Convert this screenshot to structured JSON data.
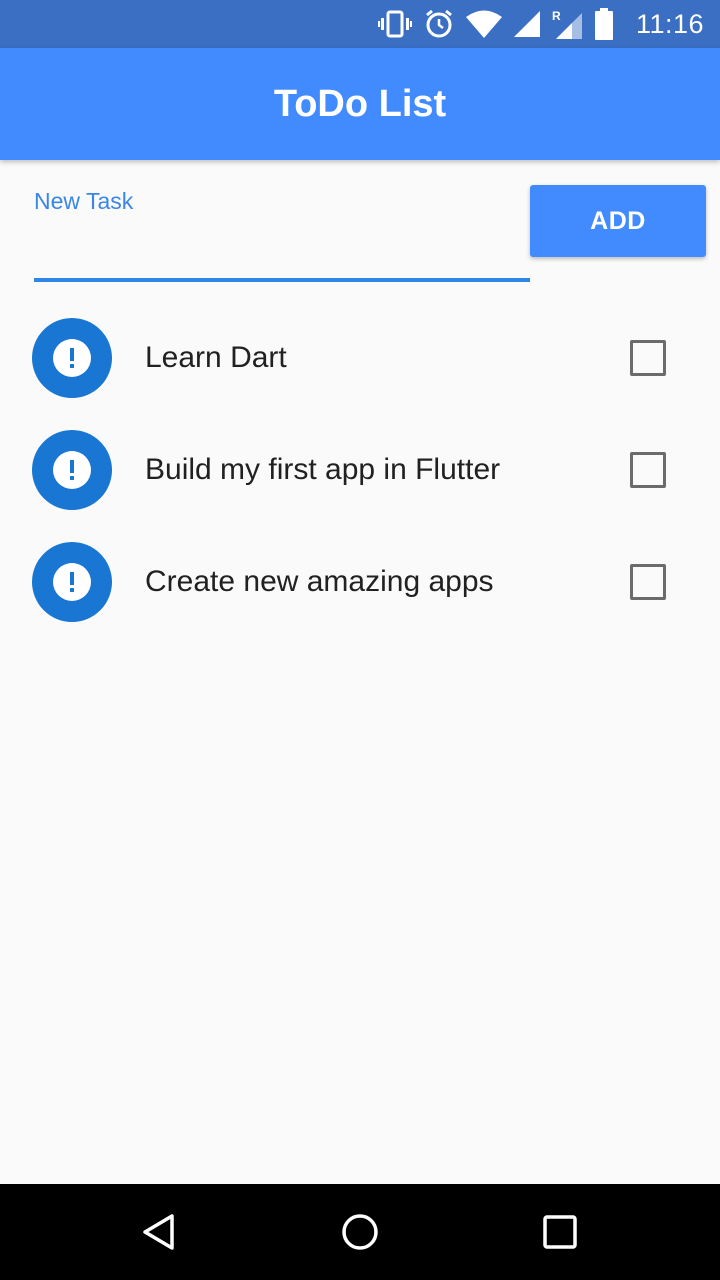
{
  "status_bar": {
    "time": "11:16",
    "icons": [
      "vibrate-icon",
      "alarm-icon",
      "wifi-icon",
      "cell-signal-icon",
      "roaming-signal-icon",
      "battery-icon"
    ],
    "roaming_indicator": "R"
  },
  "app_bar": {
    "title": "ToDo List",
    "color": "#428bff"
  },
  "new_task": {
    "label": "New Task",
    "value": "",
    "add_label": "ADD"
  },
  "tasks": [
    {
      "text": "Learn Dart",
      "icon": "priority-exclamation-icon",
      "checked": false
    },
    {
      "text": "Build my first app in Flutter",
      "icon": "priority-exclamation-icon",
      "checked": false
    },
    {
      "text": "Create new amazing apps",
      "icon": "priority-exclamation-icon",
      "checked": false
    }
  ],
  "nav_bar": {
    "buttons": [
      "back-icon",
      "home-icon",
      "recents-icon"
    ]
  },
  "colors": {
    "status_bar": "#3a6fc4",
    "accent": "#1976d2",
    "underline": "#2f86e6",
    "background": "#fafafa"
  }
}
